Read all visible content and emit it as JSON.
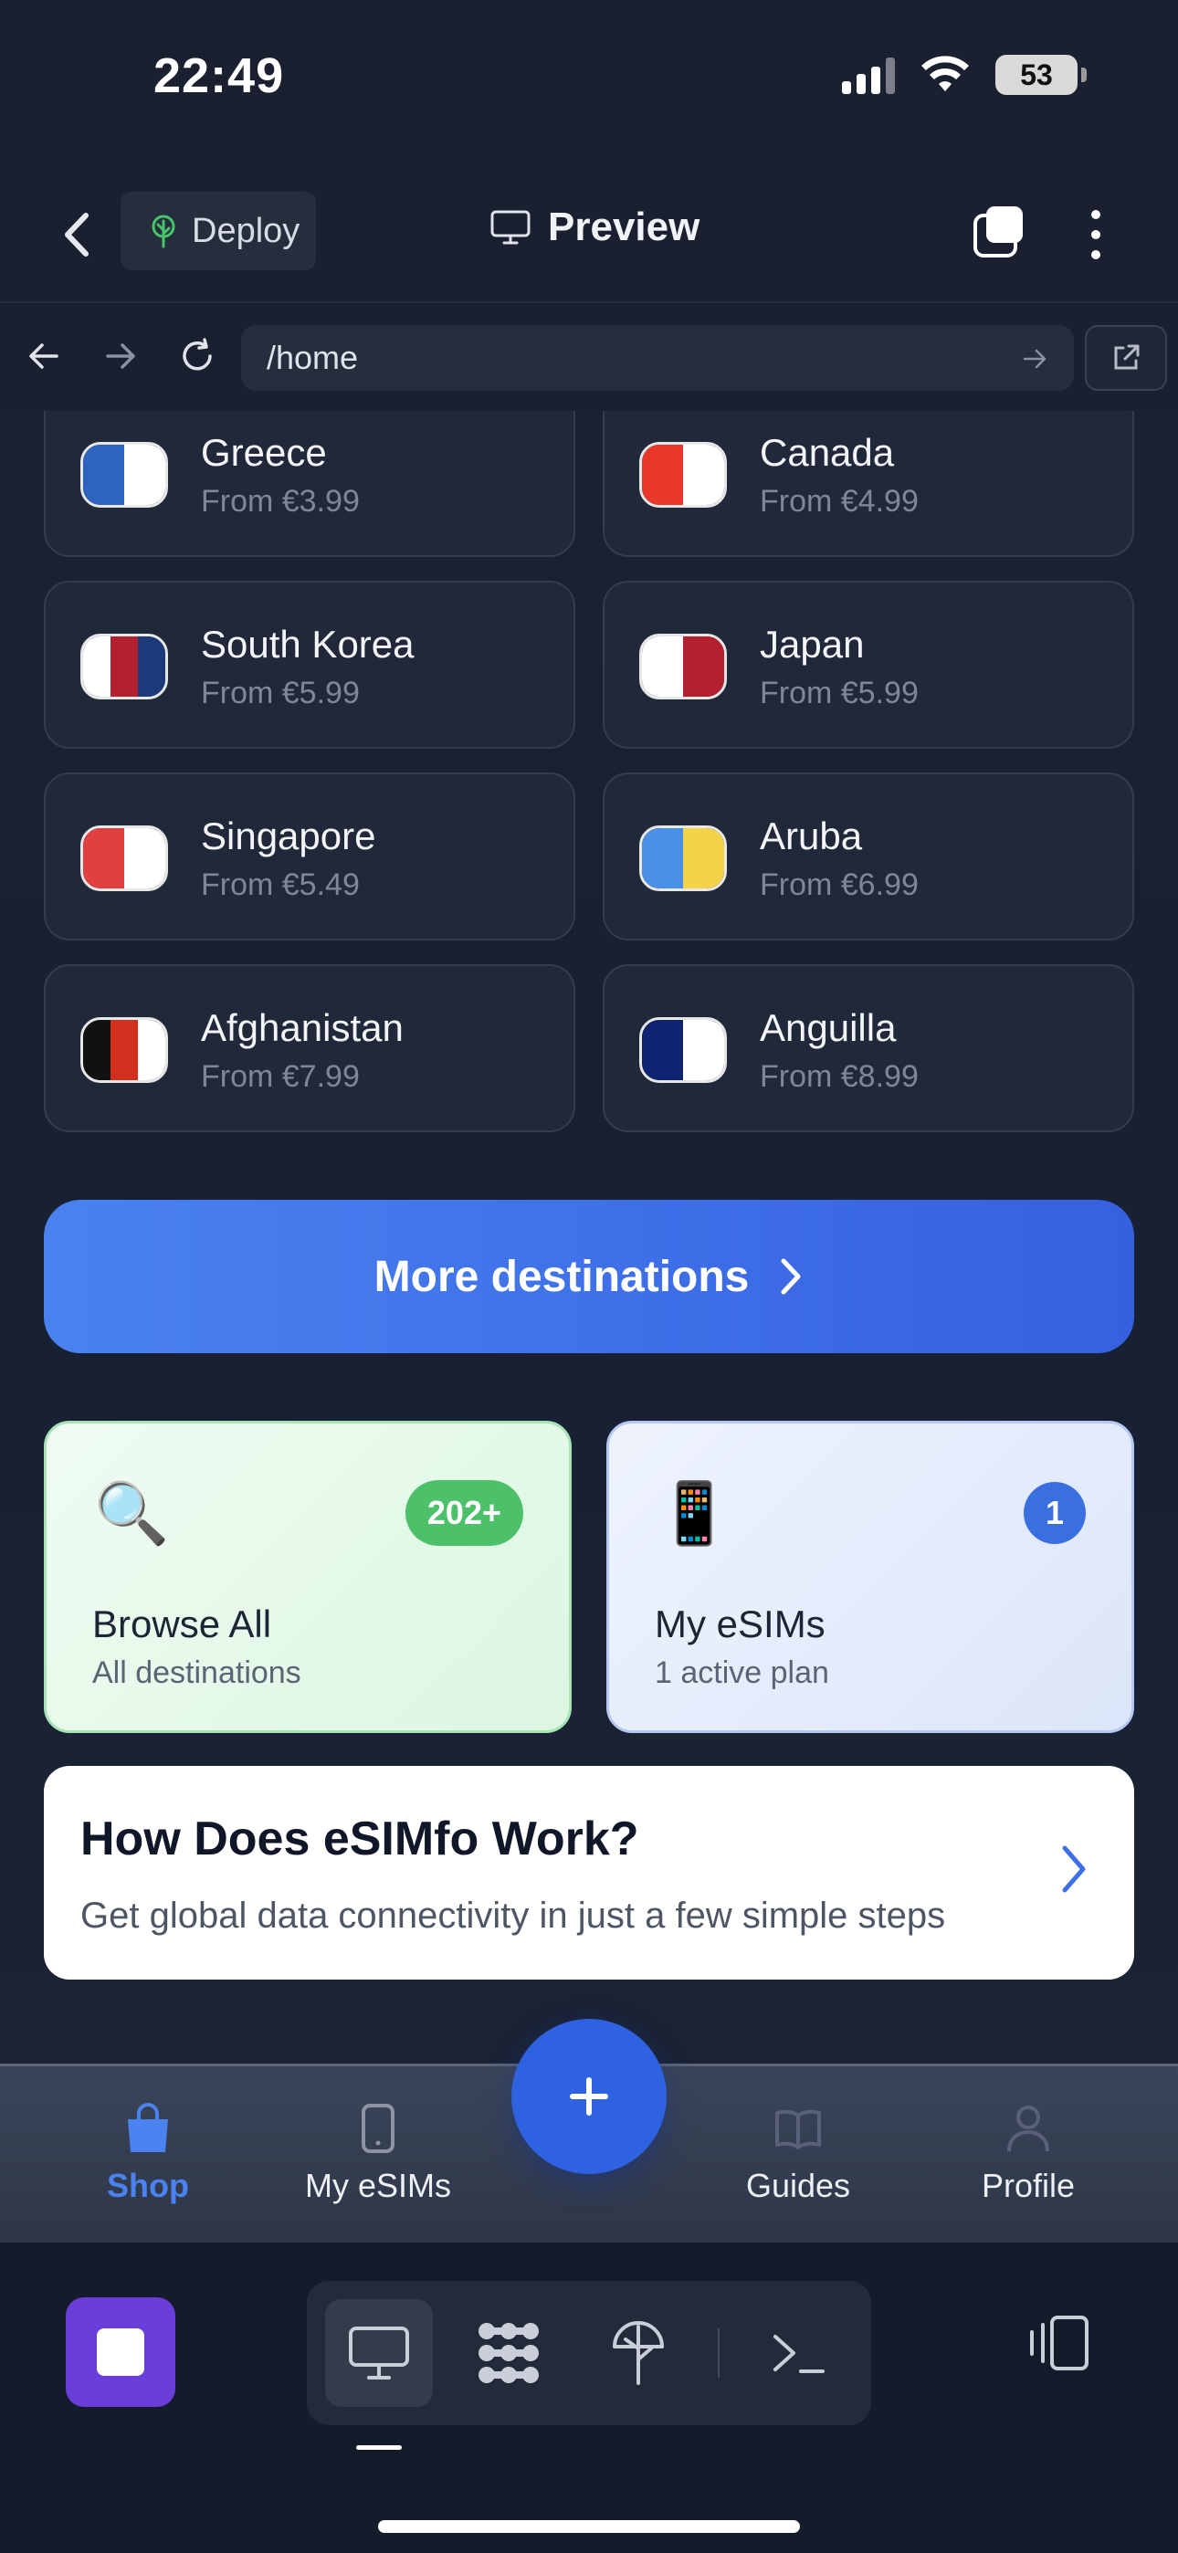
{
  "status_bar": {
    "time": "22:49",
    "battery": "53"
  },
  "header": {
    "deploy_label": "Deploy",
    "preview_label": "Preview"
  },
  "url_bar": {
    "path": "/home"
  },
  "destinations": [
    {
      "name": "Greece",
      "price": "From €3.99",
      "flag": [
        "#2f63c2",
        "#ffffff"
      ]
    },
    {
      "name": "Canada",
      "price": "From €4.99",
      "flag": [
        "#e8382a",
        "#ffffff"
      ]
    },
    {
      "name": "South Korea",
      "price": "From €5.99",
      "flag": [
        "#ffffff",
        "#b3202f",
        "#1c3a7a"
      ]
    },
    {
      "name": "Japan",
      "price": "From €5.99",
      "flag": [
        "#ffffff",
        "#b3202f"
      ]
    },
    {
      "name": "Singapore",
      "price": "From €5.49",
      "flag": [
        "#e0403f",
        "#ffffff"
      ]
    },
    {
      "name": "Aruba",
      "price": "From €6.99",
      "flag": [
        "#4a8fe8",
        "#f4d24a"
      ]
    },
    {
      "name": "Afghanistan",
      "price": "From €7.99",
      "flag": [
        "#111111",
        "#d2301f",
        "#ffffff"
      ]
    },
    {
      "name": "Anguilla",
      "price": "From €8.99",
      "flag": [
        "#0f2470",
        "#ffffff"
      ]
    }
  ],
  "more_destinations_label": "More destinations",
  "features": {
    "browse": {
      "emoji": "🔍",
      "badge": "202+",
      "title": "Browse All",
      "subtitle": "All destinations"
    },
    "esims": {
      "emoji": "📱",
      "badge": "1",
      "title": "My eSIMs",
      "subtitle": "1 active plan"
    }
  },
  "how_it_works": {
    "title": "How Does eSIMfo Work?",
    "subtitle": "Get global data connectivity in just a few simple steps"
  },
  "tab_bar": {
    "items": [
      {
        "label": "Shop",
        "icon": "shopping-bag-icon",
        "active": true
      },
      {
        "label": "My eSIMs",
        "icon": "phone-icon",
        "active": false
      },
      {
        "label": "Guides",
        "icon": "book-icon",
        "active": false
      },
      {
        "label": "Profile",
        "icon": "person-icon",
        "active": false
      }
    ],
    "fab_icon": "plus-icon"
  },
  "colors": {
    "accent": "#4a82f0",
    "fab": "#2f62e0",
    "background": "#141b2b"
  }
}
